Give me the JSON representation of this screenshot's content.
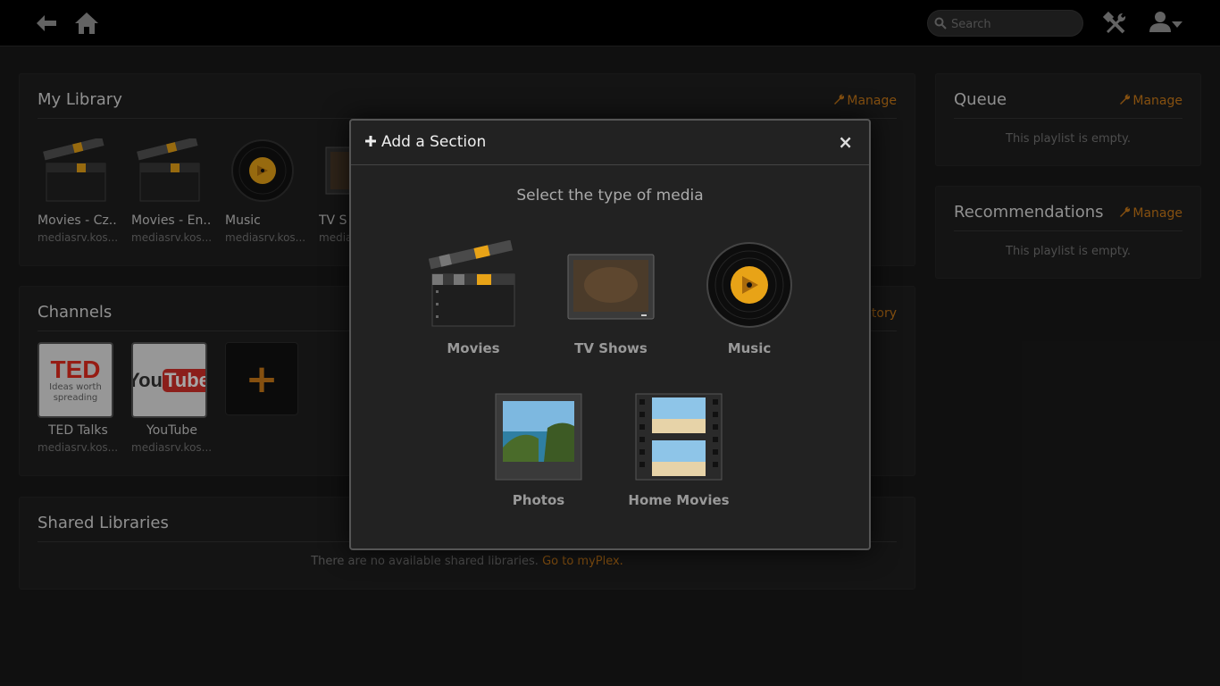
{
  "topbar": {
    "search_placeholder": "Search"
  },
  "library": {
    "title": "My Library",
    "manage_label": "Manage",
    "items": [
      {
        "name": "Movies - Cz...",
        "server": "mediasrv.kos..."
      },
      {
        "name": "Movies - En...",
        "server": "mediasrv.kos..."
      },
      {
        "name": "Music",
        "server": "mediasrv.kos..."
      },
      {
        "name": "TV S",
        "server": "media"
      }
    ]
  },
  "channels": {
    "title": "Channels",
    "directory_label": "ctory",
    "items": [
      {
        "name": "TED Talks",
        "server": "mediasrv.kos...",
        "logo_main": "TED",
        "logo_sub1": "Ideas worth",
        "logo_sub2": "spreading"
      },
      {
        "name": "YouTube",
        "server": "mediasrv.kos...",
        "logo_you": "You",
        "logo_tube": "Tube"
      }
    ],
    "add_symbol": "+"
  },
  "shared": {
    "title": "Shared Libraries",
    "empty_text": "There are no available shared libraries.",
    "link_text": "Go to myPlex."
  },
  "queue": {
    "title": "Queue",
    "manage_label": "Manage",
    "empty_text": "This playlist is empty."
  },
  "recommendations": {
    "title": "Recommendations",
    "manage_label": "Manage",
    "empty_text": "This playlist is empty."
  },
  "modal": {
    "title": "Add a Section",
    "subtitle": "Select the type of media",
    "close_symbol": "×",
    "options": [
      {
        "label": "Movies"
      },
      {
        "label": "TV Shows"
      },
      {
        "label": "Music"
      },
      {
        "label": "Photos"
      },
      {
        "label": "Home Movies"
      }
    ]
  },
  "colors": {
    "accent": "#cc7b19",
    "background": "#1a1a1a",
    "panel": "#1f1f1f"
  },
  "icons": [
    "back-arrow-icon",
    "home-icon",
    "search-icon",
    "tools-icon",
    "user-icon",
    "wrench-icon",
    "plus-icon",
    "close-icon"
  ]
}
